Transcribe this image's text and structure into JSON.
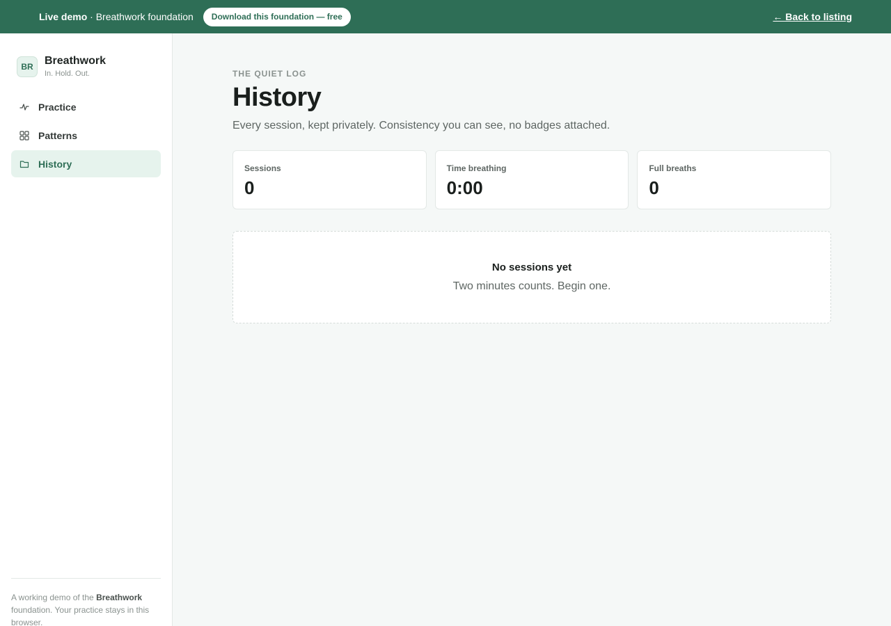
{
  "banner": {
    "demo_label": "Live demo",
    "demo_separator": " · ",
    "demo_product": "Breathwork foundation",
    "download_label": "Download this foundation — free",
    "back_label": "← Back to listing"
  },
  "sidebar": {
    "brand": {
      "logo_text": "BR",
      "name": "Breathwork",
      "tagline": "In. Hold. Out."
    },
    "items": [
      {
        "label": "Practice",
        "icon": "pulse-icon",
        "active": false
      },
      {
        "label": "Patterns",
        "icon": "grid-icon",
        "active": false
      },
      {
        "label": "History",
        "icon": "folder-icon",
        "active": true
      }
    ],
    "footer": {
      "prefix": "A working demo of the ",
      "product": "Breathwork",
      "suffix": " foundation. Your practice stays in this browser."
    }
  },
  "main": {
    "eyebrow": "THE QUIET LOG",
    "title": "History",
    "subtitle": "Every session, kept privately. Consistency you can see, no badges attached.",
    "stats": [
      {
        "label": "Sessions",
        "value": "0"
      },
      {
        "label": "Time breathing",
        "value": "0:00"
      },
      {
        "label": "Full breaths",
        "value": "0"
      }
    ],
    "empty": {
      "title": "No sessions yet",
      "text": "Two minutes counts. Begin one."
    }
  },
  "colors": {
    "accent": "#2e6e56",
    "accent_soft": "#e6f3ed",
    "background": "#f5f8f7"
  }
}
